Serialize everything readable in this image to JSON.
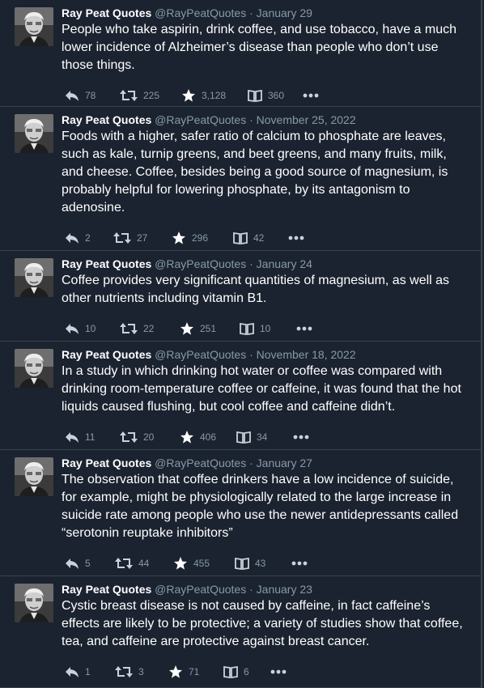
{
  "tweets": [
    {
      "name": "Ray Peat Quotes",
      "handle": "@RayPeatQuotes",
      "separator": "·",
      "date": "January 29",
      "text": "People who take aspirin, drink coffee, and use tobacco, have a much lower incidence of Alzheimer’s disease than people who don’t use those things.",
      "replies": "78",
      "retweets": "225",
      "likes": "3,128",
      "bookmarks": "360"
    },
    {
      "name": "Ray Peat Quotes",
      "handle": "@RayPeatQuotes",
      "separator": "·",
      "date": "November 25, 2022",
      "text": "Foods with a higher, safer ratio of calcium to phosphate are leaves, such as kale, turnip greens, and beet greens, and many fruits, milk, and cheese. Coffee, besides being a good source of magnesium, is probably helpful for lowering phosphate, by its antagonism to adenosine.",
      "replies": "2",
      "retweets": "27",
      "likes": "296",
      "bookmarks": "42"
    },
    {
      "name": "Ray Peat Quotes",
      "handle": "@RayPeatQuotes",
      "separator": "·",
      "date": "January 24",
      "text": "Coffee provides very significant quantities of magnesium, as well as other nutrients including vitamin B1.",
      "replies": "10",
      "retweets": "22",
      "likes": "251",
      "bookmarks": "10"
    },
    {
      "name": "Ray Peat Quotes",
      "handle": "@RayPeatQuotes",
      "separator": "·",
      "date": "November 18, 2022",
      "text": "In a study in which drinking hot water or coffee was compared with drinking room-temperature coffee or caffeine, it was found that the hot liquids caused flushing, but cool coffee and caffeine didn’t.",
      "replies": "11",
      "retweets": "20",
      "likes": "406",
      "bookmarks": "34"
    },
    {
      "name": "Ray Peat Quotes",
      "handle": "@RayPeatQuotes",
      "separator": "·",
      "date": "January 27",
      "text": "The observation that coffee drinkers have a low incidence of suicide, for example, might be physiologically related to the large increase in suicide rate among people who use the newer antidepressants called “serotonin reuptake inhibitors”",
      "replies": "5",
      "retweets": "44",
      "likes": "455",
      "bookmarks": "43"
    },
    {
      "name": "Ray Peat Quotes",
      "handle": "@RayPeatQuotes",
      "separator": "·",
      "date": "January 23",
      "text": "Cystic breast disease is not caused by caffeine, in fact caffeine’s effects are likely to be protective; a variety of studies show that coffee, tea, and caffeine are protective against breast cancer.",
      "replies": "1",
      "retweets": "3",
      "likes": "71",
      "bookmarks": "6"
    }
  ],
  "icons": {
    "reply": "reply-icon",
    "retweet": "retweet-icon",
    "like": "star-icon",
    "bookmark": "book-icon",
    "more": "more-icon"
  },
  "colors": {
    "background": "#1b2330",
    "text": "#ffffff",
    "muted": "#8899a6",
    "divider": "#38444d"
  }
}
